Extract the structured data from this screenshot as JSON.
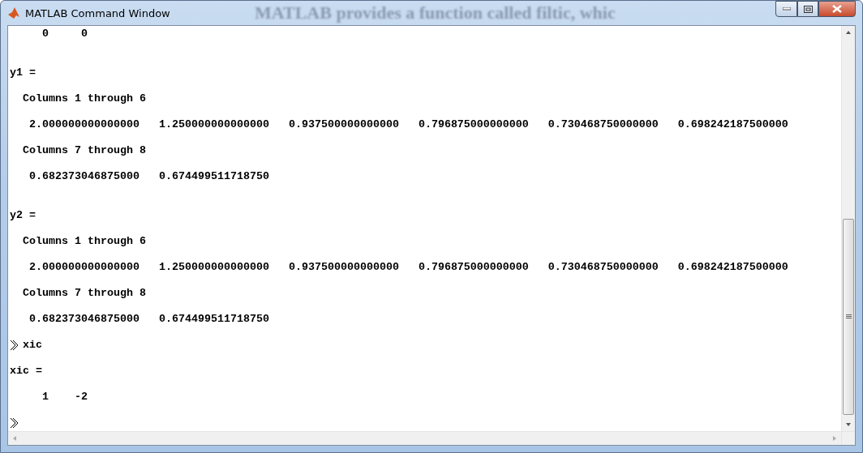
{
  "window": {
    "title": "MATLAB Command Window",
    "behind_text": "MATLAB provides a function called filtic, whic"
  },
  "lines": [
    {
      "kind": "output",
      "text": "     0     0"
    },
    {
      "kind": "blank"
    },
    {
      "kind": "blank"
    },
    {
      "kind": "output",
      "text": "y1 ="
    },
    {
      "kind": "blank"
    },
    {
      "kind": "output",
      "text": "  Columns 1 through 6"
    },
    {
      "kind": "blank"
    },
    {
      "kind": "output",
      "text": "   2.000000000000000   1.250000000000000   0.937500000000000   0.796875000000000   0.730468750000000   0.698242187500000"
    },
    {
      "kind": "blank"
    },
    {
      "kind": "output",
      "text": "  Columns 7 through 8"
    },
    {
      "kind": "blank"
    },
    {
      "kind": "output",
      "text": "   0.682373046875000   0.674499511718750"
    },
    {
      "kind": "blank"
    },
    {
      "kind": "blank"
    },
    {
      "kind": "output",
      "text": "y2 ="
    },
    {
      "kind": "blank"
    },
    {
      "kind": "output",
      "text": "  Columns 1 through 6"
    },
    {
      "kind": "blank"
    },
    {
      "kind": "output",
      "text": "   2.000000000000000   1.250000000000000   0.937500000000000   0.796875000000000   0.730468750000000   0.698242187500000"
    },
    {
      "kind": "blank"
    },
    {
      "kind": "output",
      "text": "  Columns 7 through 8"
    },
    {
      "kind": "blank"
    },
    {
      "kind": "output",
      "text": "   0.682373046875000   0.674499511718750"
    },
    {
      "kind": "blank"
    },
    {
      "kind": "prompt",
      "text": "xic"
    },
    {
      "kind": "blank"
    },
    {
      "kind": "output",
      "text": "xic ="
    },
    {
      "kind": "blank"
    },
    {
      "kind": "output",
      "text": "     1    -2"
    },
    {
      "kind": "blank"
    },
    {
      "kind": "prompt"
    }
  ]
}
